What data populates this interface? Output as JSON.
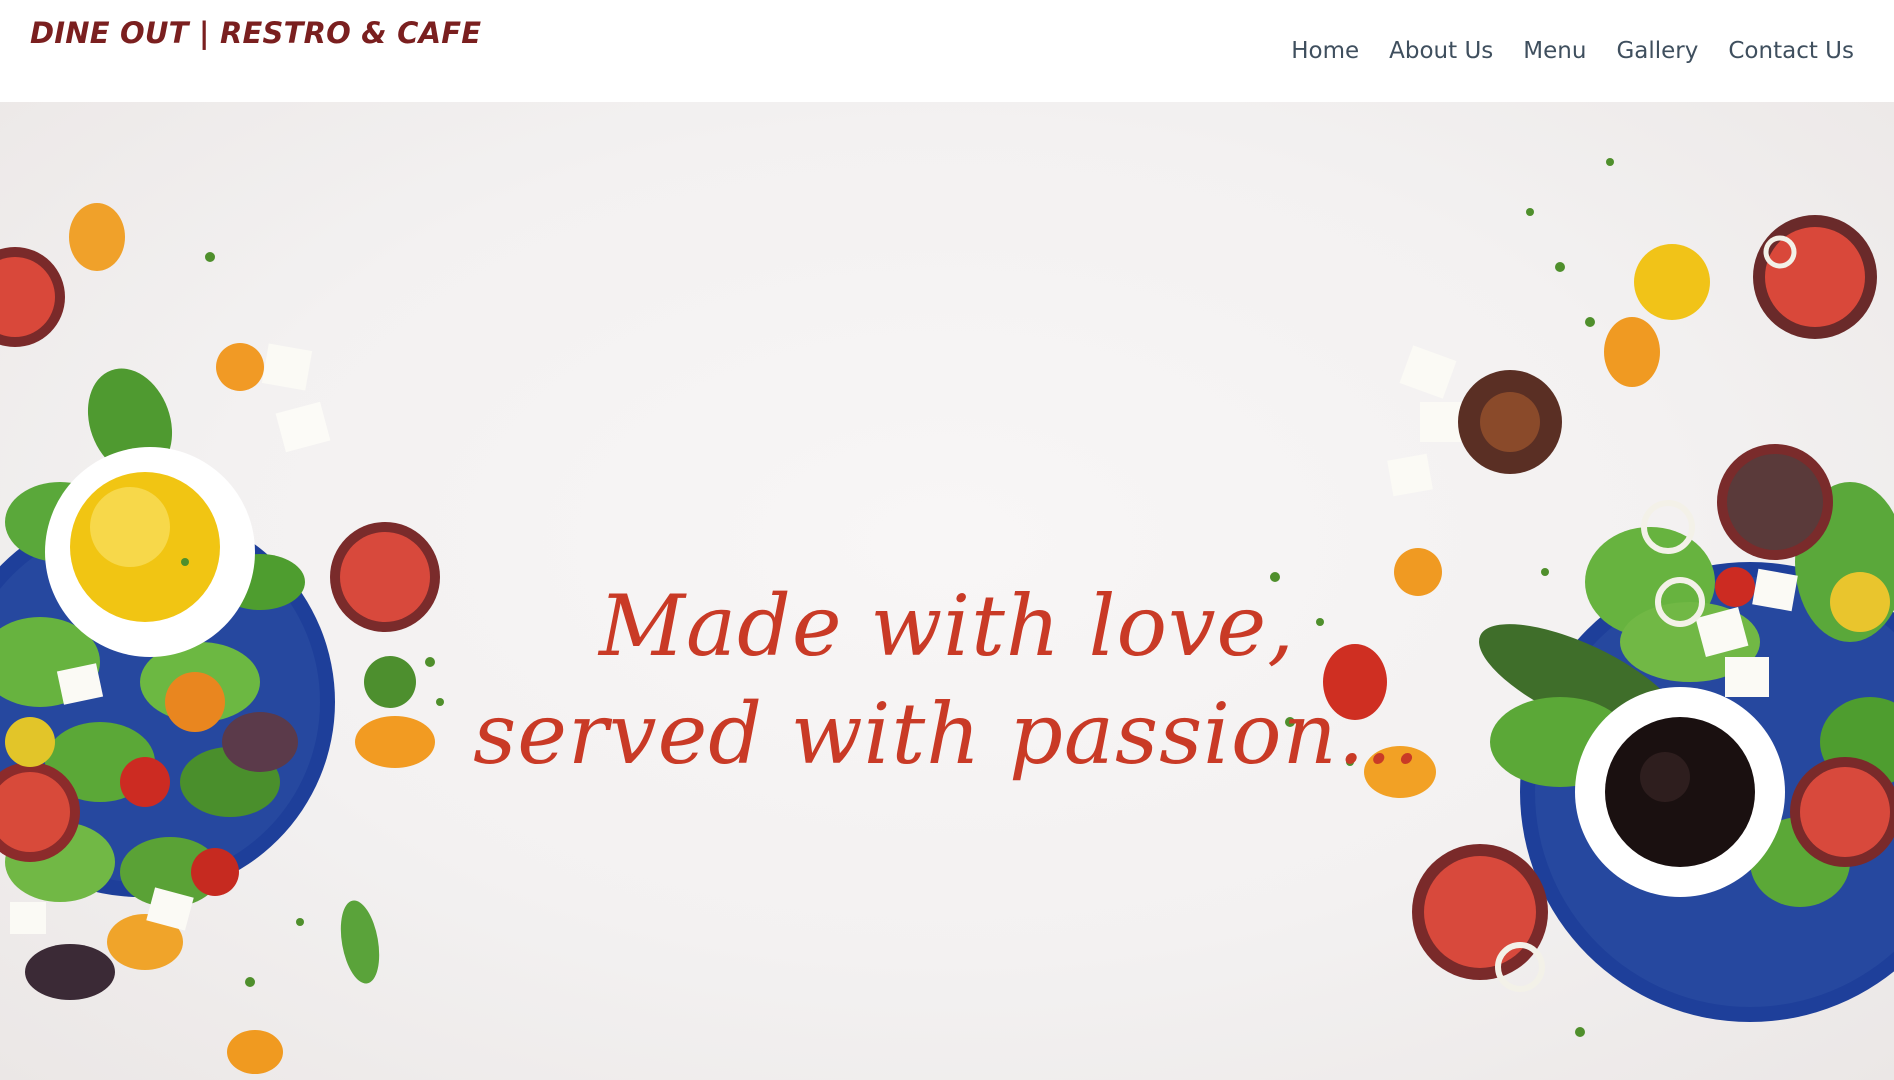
{
  "header": {
    "brand": "DINE OUT | RESTRO & CAFE",
    "nav": [
      "Home",
      "About Us",
      "Menu",
      "Gallery",
      "Contact Us"
    ]
  },
  "hero": {
    "line1": "Made with love,",
    "line2": "served with passion..."
  },
  "colors": {
    "brand": "#7a1f1f",
    "nav": "#3f4f5e",
    "tagline": "#c93a26",
    "plate": "#1e3f9a",
    "background": "#f3f1f1"
  }
}
